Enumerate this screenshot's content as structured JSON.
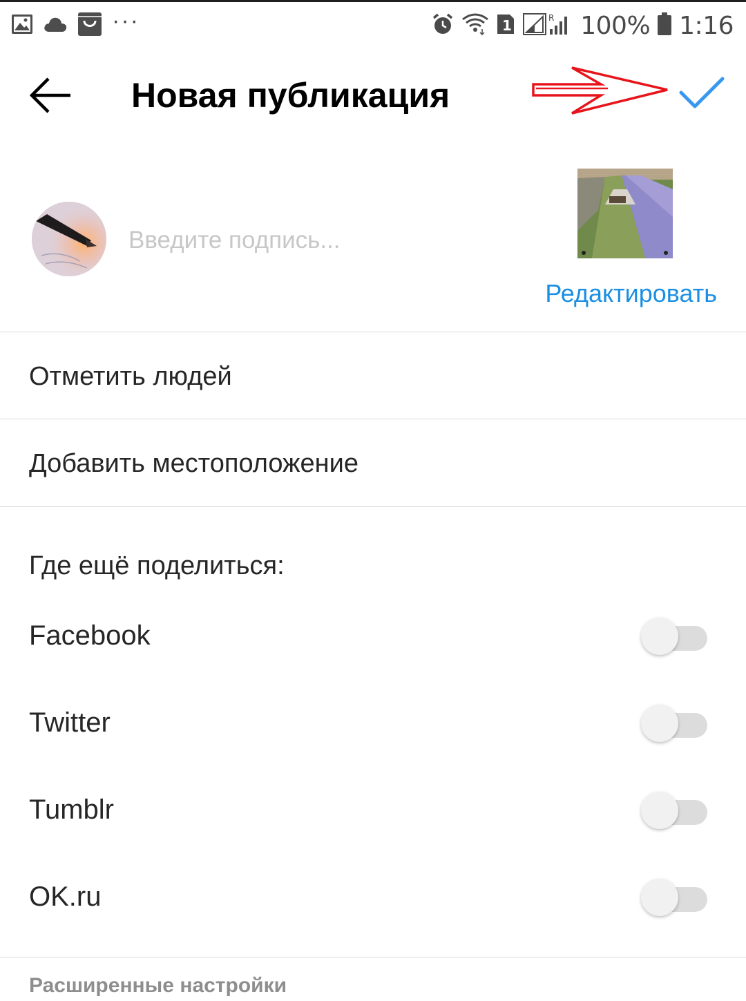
{
  "status_bar": {
    "battery_percent": "100%",
    "time": "1:16",
    "sim_slot": "1",
    "roaming_indicator": "R",
    "icons": [
      "gallery-icon",
      "cloud-icon",
      "shopping-bag-icon",
      "more-dots-icon",
      "alarm-icon",
      "wifi-icon",
      "sim-icon",
      "signal-icon",
      "battery-icon"
    ]
  },
  "header": {
    "title": "Новая публикация",
    "back_icon": "arrow-left-icon",
    "confirm_icon": "checkmark-icon",
    "accent_color": "#3897f0",
    "annotation_color": "#e8141b"
  },
  "caption": {
    "placeholder": "Введите подпись...",
    "value": "",
    "edit_label": "Редактировать",
    "edit_color": "#1a8fe3"
  },
  "options": {
    "tag_people": "Отметить людей",
    "add_location": "Добавить местоположение"
  },
  "share": {
    "title": "Где ещё поделиться:",
    "items": [
      {
        "label": "Facebook",
        "enabled": false
      },
      {
        "label": "Twitter",
        "enabled": false
      },
      {
        "label": "Tumblr",
        "enabled": false
      },
      {
        "label": "OK.ru",
        "enabled": false
      }
    ]
  },
  "advanced": {
    "label": "Расширенные настройки"
  }
}
